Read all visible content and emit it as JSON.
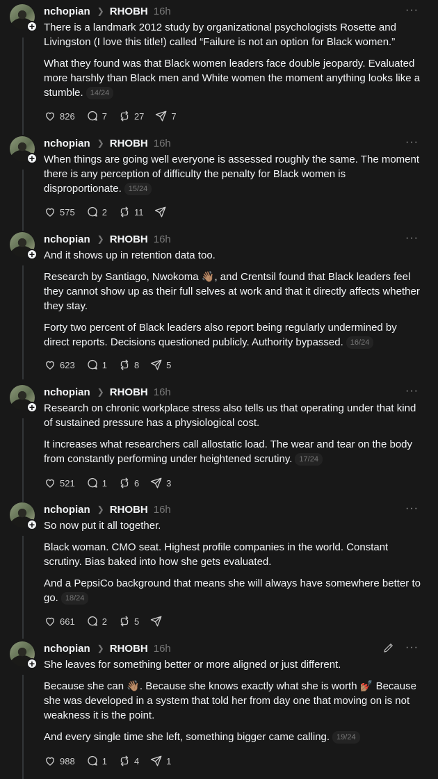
{
  "posts": [
    {
      "username": "nchopian",
      "community": "RHOBH",
      "time": "16h",
      "paragraphs": [
        "There is a landmark 2012 study by organizational psychologists Rosette and Livingston (I love this title!) called “Failure is not an option for Black women.”",
        "What they found was that Black women leaders face double jeopardy. Evaluated more harshly than Black men and White women the moment anything looks like a stumble."
      ],
      "counter": "14/24",
      "likes": "826",
      "replies": "7",
      "reposts": "27",
      "shares": "7"
    },
    {
      "username": "nchopian",
      "community": "RHOBH",
      "time": "16h",
      "paragraphs": [
        "When things are going well everyone is assessed roughly the same. The moment there is any perception of difficulty the penalty for Black women is disproportionate."
      ],
      "counter": "15/24",
      "likes": "575",
      "replies": "2",
      "reposts": "11",
      "shares": ""
    },
    {
      "username": "nchopian",
      "community": "RHOBH",
      "time": "16h",
      "paragraphs": [
        "And it shows up in retention data too.",
        "Research by Santiago, Nwokoma 👋🏽, and Crentsil found that Black leaders feel they cannot show up as their full selves at work and that it directly affects whether they stay.",
        "Forty two percent of Black leaders also report being regularly undermined by direct reports. Decisions questioned publicly. Authority bypassed."
      ],
      "counter": "16/24",
      "likes": "623",
      "replies": "1",
      "reposts": "8",
      "shares": "5"
    },
    {
      "username": "nchopian",
      "community": "RHOBH",
      "time": "16h",
      "paragraphs": [
        "Research on chronic workplace stress also tells us that operating under that kind of sustained pressure has a physiological cost.",
        "It increases what researchers call allostatic load. The wear and tear on the body from constantly performing under heightened scrutiny."
      ],
      "counter": "17/24",
      "likes": "521",
      "replies": "1",
      "reposts": "6",
      "shares": "3"
    },
    {
      "username": "nchopian",
      "community": "RHOBH",
      "time": "16h",
      "paragraphs": [
        "So now put it all together.",
        "Black woman. CMO seat. Highest profile companies in the world. Constant scrutiny. Bias baked into how she gets evaluated.",
        "And a PepsiCo background that means she will always have somewhere better to go."
      ],
      "counter": "18/24",
      "likes": "661",
      "replies": "2",
      "reposts": "5",
      "shares": ""
    },
    {
      "username": "nchopian",
      "community": "RHOBH",
      "time": "16h",
      "paragraphs": [
        "She leaves for something better or more aligned or just different.",
        "Because she can 👋🏽. Because she knows exactly what she is worth 💅🏽 Because she was developed in a system that told her from day one that moving on is not weakness it is the point.",
        "And every single time she left, something bigger came calling."
      ],
      "counter": "19/24",
      "likes": "988",
      "replies": "1",
      "reposts": "4",
      "shares": "1"
    }
  ]
}
